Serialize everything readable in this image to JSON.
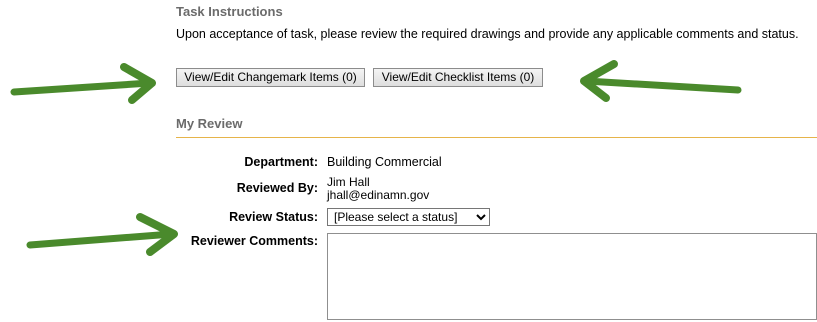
{
  "task_instructions": {
    "title": "Task Instructions",
    "text": "Upon acceptance of task, please review the required drawings and provide any applicable comments and status."
  },
  "buttons": {
    "changemark": "View/Edit Changemark Items (0)",
    "checklist": "View/Edit Checklist Items (0)"
  },
  "my_review": {
    "title": "My Review",
    "department_label": "Department:",
    "department_value": "Building Commercial",
    "reviewed_by_label": "Reviewed By:",
    "reviewer_name": "Jim Hall",
    "reviewer_email": "jhall@edinamn.gov",
    "status_label": "Review Status:",
    "status_selected": "[Please select a status]",
    "comments_label": "Reviewer Comments:",
    "comments_value": ""
  },
  "colors": {
    "arrow_green": "#4a8a2c",
    "rule_gold": "#e6b44a",
    "section_title_gray": "#6b6b6b"
  },
  "icons": [
    "arrow-right-icon",
    "arrow-left-icon",
    "arrow-right-icon"
  ]
}
